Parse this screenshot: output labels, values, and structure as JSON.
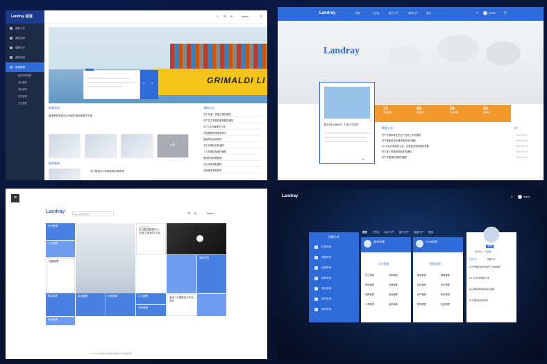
{
  "panel1": {
    "logo": "Landray 蓝凌",
    "nav": [
      {
        "label": "我的工作"
      },
      {
        "label": "我的空间"
      },
      {
        "label": "我的门户"
      },
      {
        "label": "我的应用"
      },
      {
        "label": "系统管理"
      }
    ],
    "subnav": [
      "组织架构管理",
      "岗位管理",
      "角色管理",
      "权限管理",
      "日志管理"
    ],
    "user": "Admin",
    "ship_text": "GRIMALDI LI",
    "news_section": "新闻资讯",
    "news_title": "蓝凌荣获智慧办公领域年度优秀解决方案",
    "notice_section": "通知公告",
    "notice_items": [
      "关于年度、季度汇报的通知",
      "关于员工考勤制度调整的通知",
      "KK 平台升级维护公告",
      "文档管理系统使用指引",
      "蓝凌年会活动安排",
      "关于开展培训的通知",
      "人力资源信息维护通知",
      "集团财务制度更新",
      "办公用品领取通知",
      "系统使用手册发布"
    ],
    "related_section": "推荐新闻",
    "related_title": "关于智慧办公的新实践与新思考",
    "plus_label": "+5"
  },
  "panel2": {
    "logo": "Landray",
    "tabs": [
      "首页",
      "工作台",
      "部门门户",
      "我的门户",
      "更多"
    ],
    "user": "Admin",
    "brand": "Landray",
    "card_title": "数字化办公新时代，打造“共享协同”",
    "stats": [
      {
        "n": "12",
        "l": "待办事项"
      },
      {
        "n": "28",
        "l": "待阅文件"
      },
      {
        "n": "28",
        "l": "我的流程"
      },
      {
        "n": "28",
        "l": "待审批"
      }
    ],
    "ann_title": "最新公告",
    "ann_more": "更多",
    "ann_items": [
      {
        "t": "关于开展年度安全生产检查工作的通知",
        "d": "2017-09-21"
      },
      {
        "t": "关于集团信息化建设推进会的通知",
        "d": "2017-09-18"
      },
      {
        "t": "KK 平台升级维护公告，请各部门提前做好准备",
        "d": "2017-09-15"
      },
      {
        "t": "关于第三季度财务报表的通知",
        "d": "2017-09-10"
      },
      {
        "t": "关于开展消防演练的通知",
        "d": "2017-07-24"
      }
    ]
  },
  "panel3": {
    "logo": "Landray",
    "search_placeholder": "输入关键词搜索",
    "user": "Admin",
    "tiles": {
      "t1": "任务管理",
      "t2": "人力资源",
      "t3": "流程管理",
      "t4": "基本事项",
      "t5": "会议管理",
      "t6": "财务报销",
      "t7": "公文管理",
      "t8": "合同管理",
      "t9": "我的文档",
      "t10": "项目管理"
    },
    "hero_title": "全力推进智慧办公，打造“共享协同”平台",
    "hero_date": "2018-06-11",
    "news_title": "蓝凌 OA 智能办公平台发布",
    "footer": "© 2018 深圳市蓝凌软件股份有限公司 版权所有"
  },
  "panel4": {
    "logo": "Landray",
    "user": "Admin",
    "quick_title": "快捷方式",
    "quick_items": [
      "机票申请",
      "请假申请",
      "出差申请",
      "报销申请",
      "用车申请",
      "用车申请",
      "用车申请"
    ],
    "tabs": [
      "首页",
      "工作台",
      "私人门户",
      "部门门户",
      "信息门户",
      "更多"
    ],
    "colA": {
      "title": "成本系统",
      "sub": "人力系统",
      "mods": [
        "员工档案",
        "考勤管理",
        "薪资管理",
        "绩效管理",
        "招聘管理",
        "培训管理",
        "人事报表",
        "组织管理"
      ]
    },
    "colB": {
      "title": "CRM系统",
      "sub": "财务系统",
      "mods": [
        "费用报销",
        "预算管理",
        "应收管理",
        "应付管理",
        "资产管理",
        "税务管理",
        "财务报表",
        "资金管理"
      ]
    },
    "profile": {
      "name": "张明",
      "dept": "研发中心 · 产品部",
      "items": [
        "待办 20",
        "待阅 10"
      ],
      "lines": [
        "关于开展年度安全检查工作的通知",
        "KK 平台升级维护公告",
        "第三季度财务报表提交提醒",
        "关于消防演练的安排"
      ]
    }
  },
  "colors": {
    "accent": "#2f6bd8",
    "orange": "#f39a2e",
    "dark_nav": "#1d2a45"
  }
}
